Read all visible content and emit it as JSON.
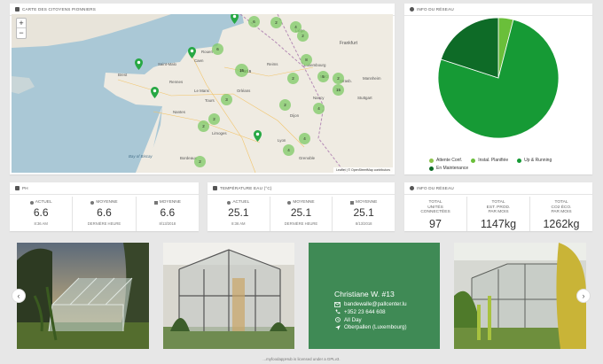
{
  "map_card": {
    "title": "CARTE DES CITOYENS PIONNIERS",
    "attribution": "Leaflet | © OpenStreetMap contributors"
  },
  "map_labels": [
    "Rouen",
    "Paris",
    "Saint-Malo",
    "Luxembourg",
    "Strasb.",
    "Rennes",
    "Nantes",
    "Lyon",
    "Grenoble",
    "Nancy",
    "Reims",
    "Tours",
    "Dijon",
    "Frankfurt",
    "Stuttgart",
    "Liège",
    "Brest",
    "Bordeaux",
    "Limoges",
    "Caen",
    "Le Mans",
    "Orléans",
    "Metz",
    "Bay of Biscay",
    "Mannheim"
  ],
  "clusters": [
    "6",
    "2",
    "4",
    "2",
    "6",
    "16",
    "8",
    "2",
    "5",
    "2",
    "4",
    "3",
    "2",
    "2",
    "4",
    "4",
    "2",
    "2",
    "15"
  ],
  "network_card": {
    "title": "INFO DU RÉSEAU"
  },
  "pie": {
    "chart_data": {
      "type": "pie",
      "labels": [
        "Attente Conf.",
        "Instal. Planifiée",
        "Up & Running",
        "En Maintenance"
      ],
      "values": [
        0,
        4,
        76,
        20
      ],
      "colors": [
        "#8bc34a",
        "#6abf3a",
        "#169a35",
        "#0e6b27"
      ]
    }
  },
  "ph": {
    "title": "PH",
    "items": [
      {
        "label": "ACTUEL",
        "value": "6.6",
        "sub": "8:36 AM"
      },
      {
        "label": "MOYENNE",
        "value": "6.6",
        "sub": "DERNIÈRE HEURE"
      },
      {
        "label": "MOYENNE",
        "value": "6.6",
        "sub": "8/13/2018"
      }
    ]
  },
  "temp": {
    "title": "TEMPÉRATURE EAU (°C)",
    "items": [
      {
        "label": "ACTUEL",
        "value": "25.1",
        "sub": "8:36 AM"
      },
      {
        "label": "MOYENNE",
        "value": "25.1",
        "sub": "DERNIÈRE HEURE"
      },
      {
        "label": "MOYENNE",
        "value": "25.1",
        "sub": "8/13/2018"
      }
    ]
  },
  "network_info": {
    "title": "INFO DU RÉSEAU",
    "items": [
      {
        "label1": "TOTAL",
        "label2": "UNITÉS",
        "label3": "CONNECTÉES",
        "value": "97"
      },
      {
        "label1": "TOTAL",
        "label2": "EST. PROD.",
        "label3": "PAR MOIS",
        "value": "1147kg"
      },
      {
        "label1": "TOTAL",
        "label2": "CO2 ÉCO.",
        "label3": "PAR MOIS",
        "value": "1262kg"
      }
    ]
  },
  "profile": {
    "name": "Christiane W. #13",
    "email": "bandewalle@pallcenter.lu",
    "phone": "+352 23 644 608",
    "hours": "All Day",
    "location": "Oberpallen (Luxembourg)"
  },
  "footer": "...myfoodappHub is licensed under a GPLv3."
}
